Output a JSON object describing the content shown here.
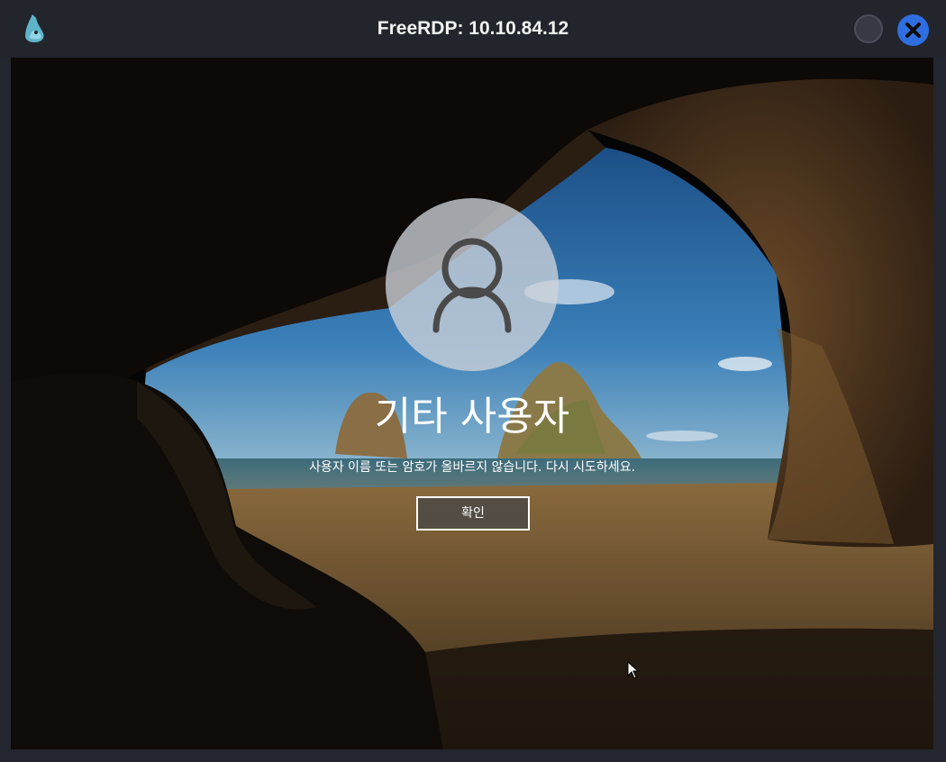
{
  "window": {
    "title": "FreeRDP: 10.10.84.12",
    "app_icon": "freerdp-icon",
    "controls": {
      "minimize_icon": "circle-icon",
      "close_icon": "close-icon",
      "close_color": "#2f6ee0"
    }
  },
  "login": {
    "avatar_icon": "user-icon",
    "username": "기타 사용자",
    "message": "사용자 이름 또는 암호가 올바르지 않습니다. 다시 시도하세요.",
    "ok_label": "확인"
  },
  "colors": {
    "titlebar": "#22252c",
    "sky": "#2d6fae",
    "sand": "#7a5a32"
  }
}
